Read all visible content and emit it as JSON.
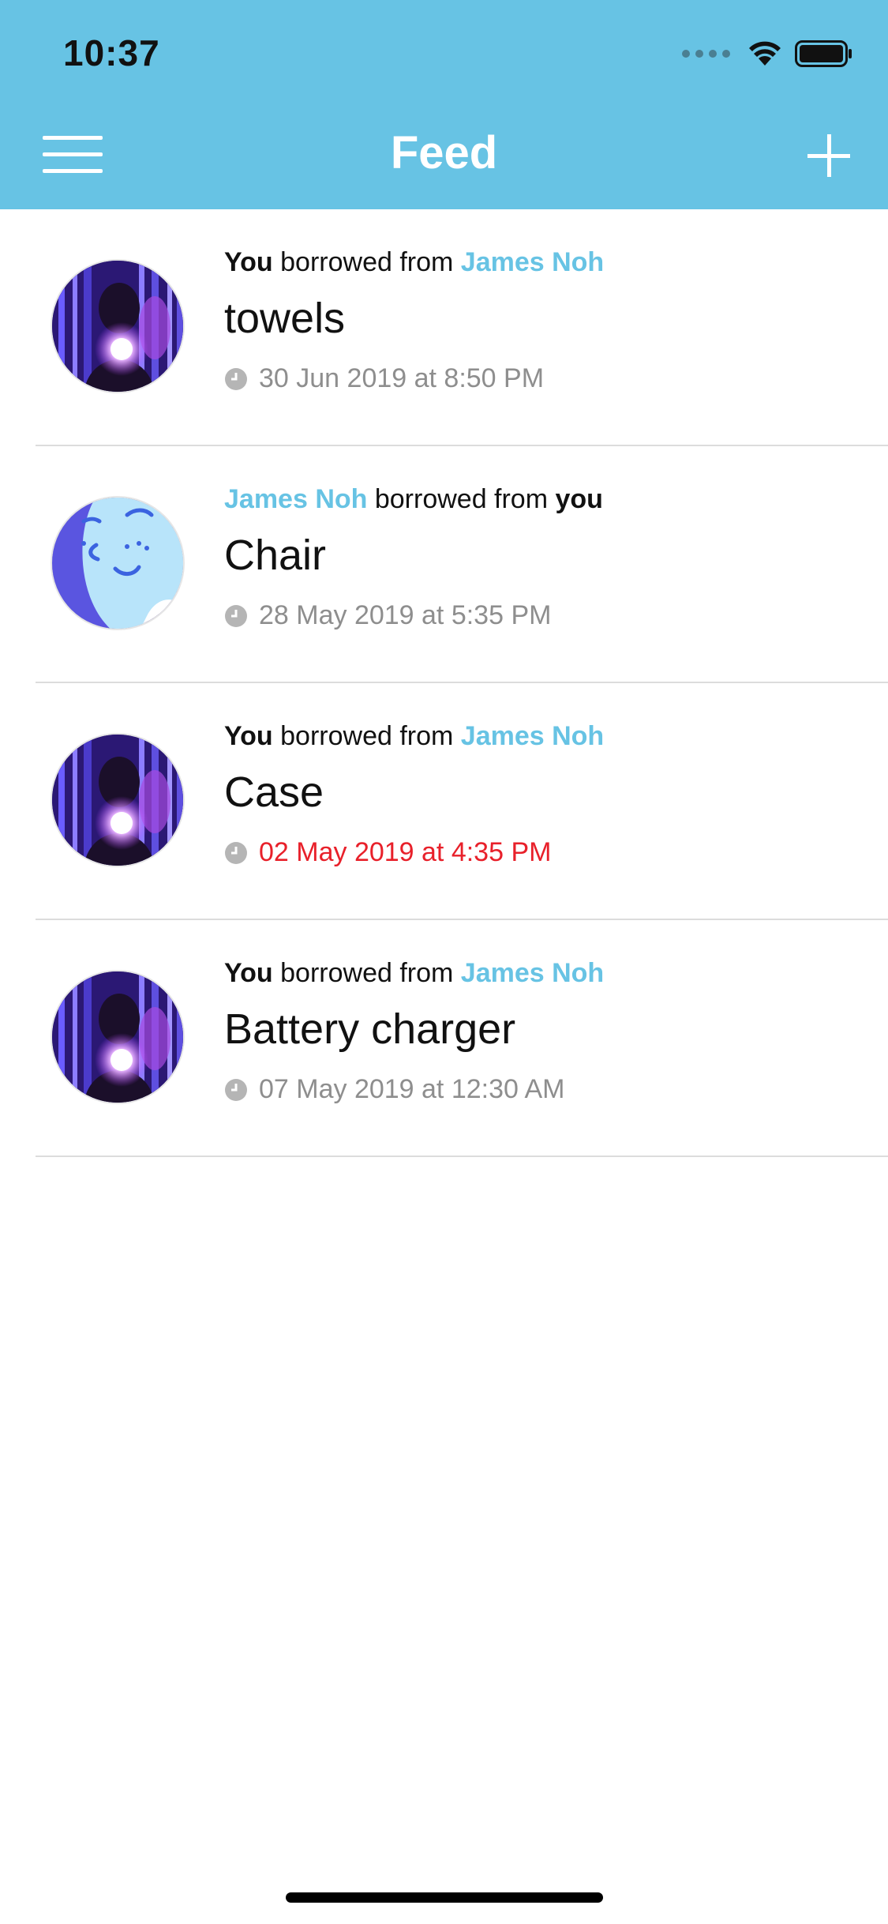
{
  "status_bar": {
    "time": "10:37"
  },
  "nav": {
    "title": "Feed",
    "menu_icon": "hamburger-menu-icon",
    "add_icon": "plus-icon"
  },
  "colors": {
    "accent": "#67c3e4",
    "overdue": "#e8202a",
    "muted": "#8e8e8e"
  },
  "feed": [
    {
      "actor": "You",
      "verb": " borrowed from ",
      "other": "James Noh",
      "actor_style": "bold",
      "other_style": "blue",
      "item": "towels",
      "time": "30 Jun 2019 at 8:50 PM",
      "overdue": false,
      "avatar": "photo"
    },
    {
      "actor": "James Noh",
      "verb": " borrowed from ",
      "other": "you",
      "actor_style": "blue",
      "other_style": "bold",
      "item": "Chair",
      "time": "28 May 2019 at 5:35 PM",
      "overdue": false,
      "avatar": "cartoon"
    },
    {
      "actor": "You",
      "verb": " borrowed from ",
      "other": "James Noh",
      "actor_style": "bold",
      "other_style": "blue",
      "item": "Case",
      "time": "02 May 2019 at 4:35 PM",
      "overdue": true,
      "avatar": "photo"
    },
    {
      "actor": "You",
      "verb": " borrowed from ",
      "other": "James Noh",
      "actor_style": "bold",
      "other_style": "blue",
      "item": "Battery charger",
      "time": "07 May 2019 at 12:30 AM",
      "overdue": false,
      "avatar": "photo"
    }
  ]
}
